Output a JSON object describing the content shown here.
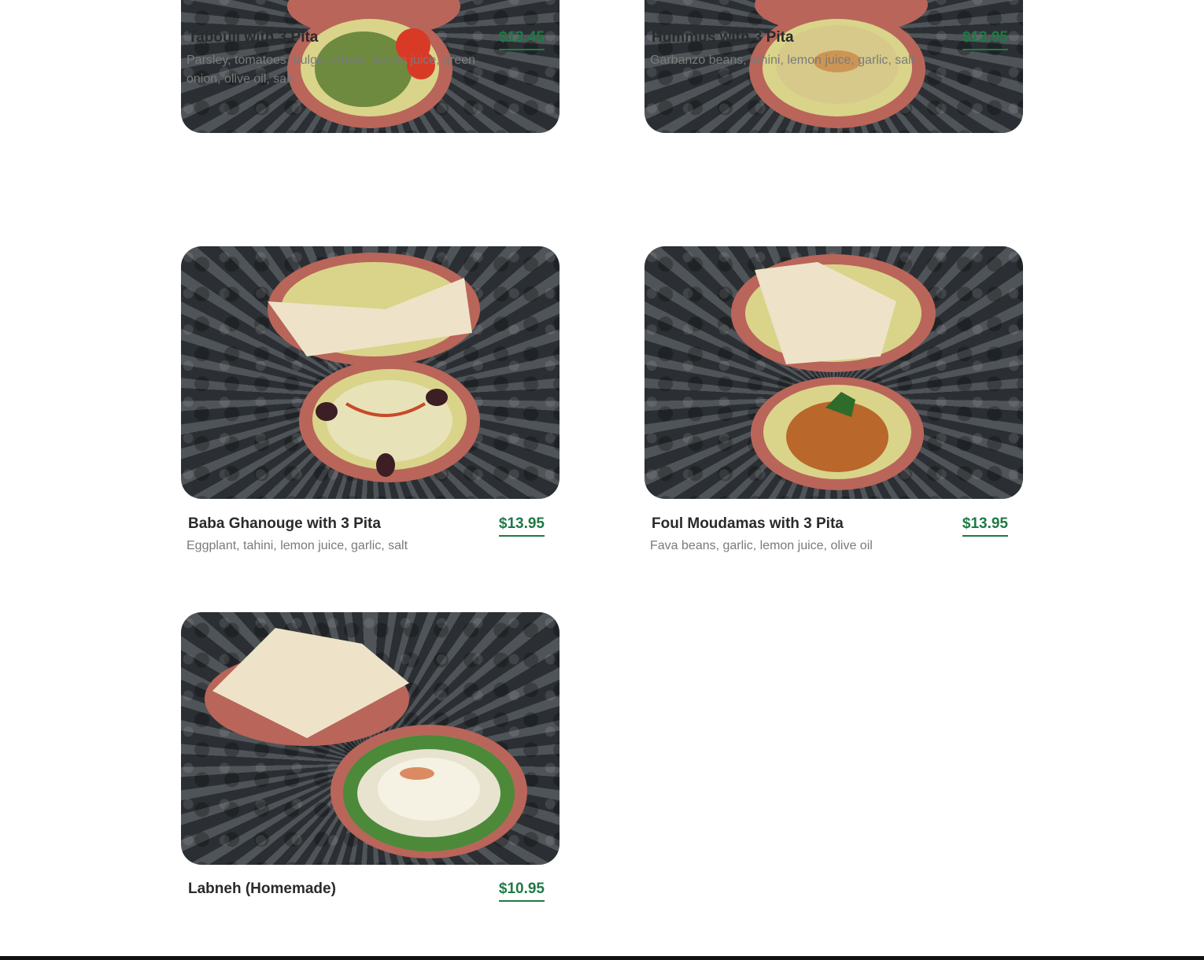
{
  "menu": {
    "items": [
      {
        "name": "Tabouli with 3 Pita",
        "price": "$13.45",
        "description": "Parsley, tomatoes, bulgur wheat, lemon juice, green onion, olive oil, salt"
      },
      {
        "name": "Hummus with 3 Pita",
        "price": "$13.95",
        "description": "Garbanzo beans, tahini, lemon juice, garlic, salt"
      },
      {
        "name": "Baba Ghanouge with 3 Pita",
        "price": "$13.95",
        "description": "Eggplant, tahini, lemon juice, garlic, salt"
      },
      {
        "name": "Foul Moudamas with 3 Pita",
        "price": "$13.95",
        "description": "Fava beans, garlic, lemon juice, olive oil"
      },
      {
        "name": "Labneh (Homemade)",
        "price": "$10.95",
        "description": ""
      }
    ]
  },
  "colors": {
    "price": "#1e7a46",
    "title": "#2a2a2a",
    "description": "#7a7a7a"
  }
}
